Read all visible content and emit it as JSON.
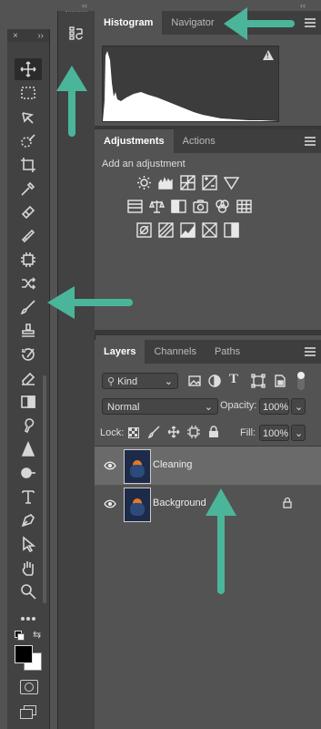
{
  "topstrip": {
    "collapse_left": "‹‹",
    "collapse_right": "‹‹"
  },
  "tools_panel": {
    "header": {
      "close": "×",
      "expand": "››"
    },
    "tools": [
      "move-tool",
      "marquee-tool",
      "lasso-tool",
      "quick-selection-tool",
      "crop-tool",
      "eyedropper-tool",
      "healing-brush-tool",
      "patch-tool",
      "frame-tool",
      "content-aware-move-tool",
      "brush-tool",
      "clone-stamp-tool",
      "history-brush-tool",
      "eraser-tool",
      "gradient-tool",
      "smudge-tool",
      "sharpen-tool",
      "dodge-tool",
      "type-tool",
      "pen-tool",
      "path-selection-tool",
      "hand-tool",
      "zoom-tool",
      "more-tools"
    ]
  },
  "histogram_panel": {
    "tabs": [
      {
        "label": "Histogram",
        "active": true
      },
      {
        "label": "Navigator",
        "active": false
      }
    ],
    "warning": "!"
  },
  "adjustments_panel": {
    "tabs": [
      {
        "label": "Adjustments",
        "active": true
      },
      {
        "label": "Actions",
        "active": false
      }
    ],
    "heading": "Add an adjustment"
  },
  "layers_panel": {
    "tabs": [
      {
        "label": "Layers",
        "active": true
      },
      {
        "label": "Channels",
        "active": false
      },
      {
        "label": "Paths",
        "active": false
      }
    ],
    "filter_kind": "Kind",
    "blend_mode": "Normal",
    "opacity_label": "Opacity:",
    "opacity_value": "100%",
    "lock_label": "Lock:",
    "fill_label": "Fill:",
    "fill_value": "100%",
    "layers": [
      {
        "name": "Cleaning",
        "selected": true,
        "locked": false
      },
      {
        "name": "Background",
        "selected": false,
        "locked": true
      }
    ]
  },
  "colors": {
    "accent_arrow": "#4bb59a",
    "panel_bg": "#535353",
    "tabbar_bg": "#3e3e3e"
  }
}
